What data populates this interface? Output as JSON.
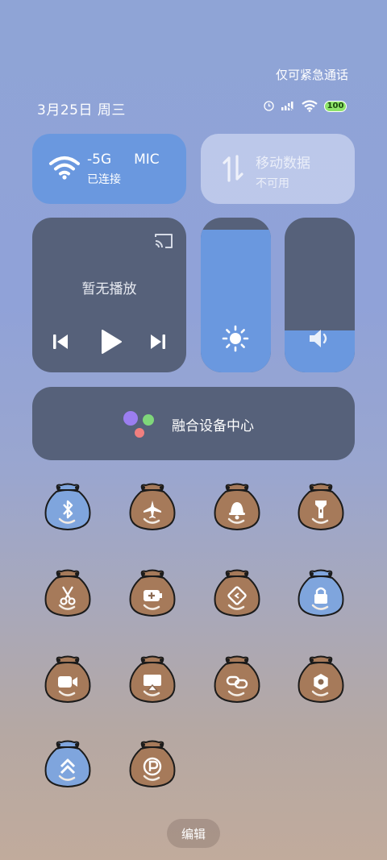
{
  "status_bar": {
    "emergency_text": "仅可紧急通话",
    "date_text": "3月25日 周三",
    "battery_level": "100"
  },
  "wifi_tile": {
    "network_name_a": "-5G",
    "network_name_b": "MIC",
    "status": "已连接"
  },
  "mobile_data_tile": {
    "title": "移动数据",
    "status": "不可用"
  },
  "media": {
    "title": "暂无播放"
  },
  "sliders": {
    "brightness_level": 0.92,
    "volume_level": 0.27
  },
  "device_hub": {
    "label": "融合设备中心"
  },
  "toggles": [
    {
      "name": "bluetooth",
      "icon": "bluetooth-icon",
      "active": true
    },
    {
      "name": "airplane-mode",
      "icon": "airplane-icon",
      "active": false
    },
    {
      "name": "sound",
      "icon": "bell-icon",
      "active": false
    },
    {
      "name": "flashlight",
      "icon": "flashlight-icon",
      "active": false
    },
    {
      "name": "screenshot",
      "icon": "scissors-icon",
      "active": false
    },
    {
      "name": "battery-saver",
      "icon": "battery-plus-icon",
      "active": false
    },
    {
      "name": "auto-rotate",
      "icon": "rotate-icon",
      "active": false
    },
    {
      "name": "rotation-lock",
      "icon": "lock-icon",
      "active": true
    },
    {
      "name": "screen-record",
      "icon": "video-camera-icon",
      "active": false
    },
    {
      "name": "screen-cast",
      "icon": "cast-icon",
      "active": false
    },
    {
      "name": "link-share",
      "icon": "link-icon",
      "active": false
    },
    {
      "name": "settings",
      "icon": "gear-icon",
      "active": false
    },
    {
      "name": "data-saver",
      "icon": "double-chevron-up-icon",
      "active": true
    },
    {
      "name": "priority-mode",
      "icon": "p-circle-icon",
      "active": false
    }
  ],
  "edit_button": {
    "label": "编辑"
  }
}
